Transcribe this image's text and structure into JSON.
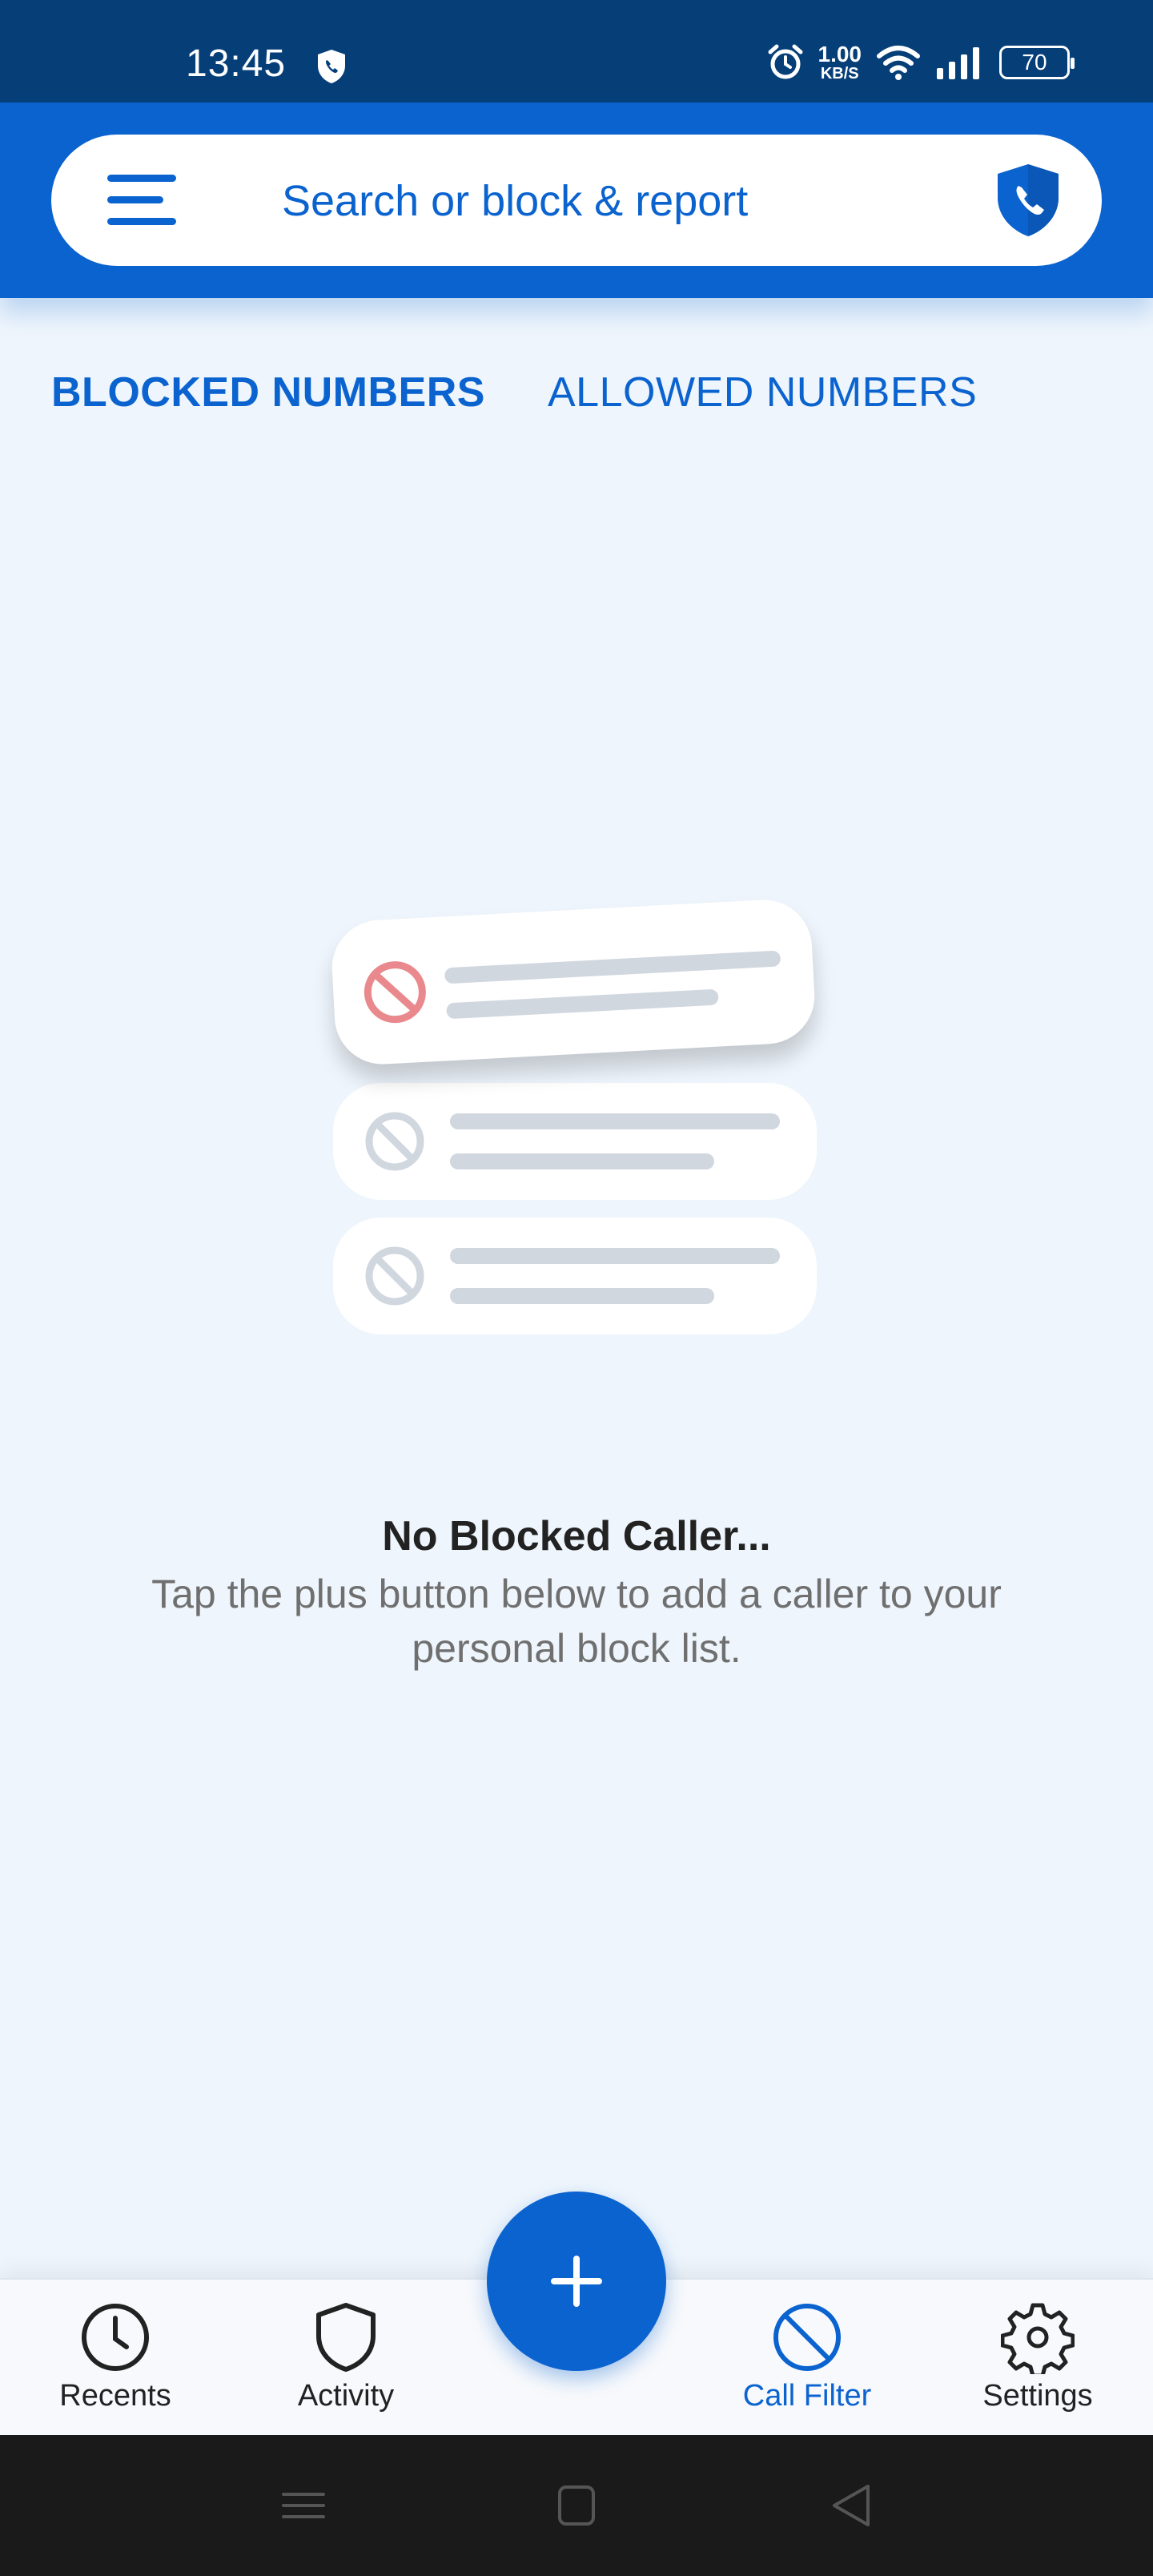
{
  "status_bar": {
    "time": "13:45",
    "network_speed_value": "1.00",
    "network_speed_unit": "KB/S",
    "battery_level": "70"
  },
  "header": {
    "search_placeholder": "Search or block & report"
  },
  "tabs": [
    {
      "label": "BLOCKED NUMBERS",
      "active": true
    },
    {
      "label": "ALLOWED NUMBERS",
      "active": false
    }
  ],
  "empty_state": {
    "title": "No Blocked Caller...",
    "description": "Tap the plus button below to add a caller to your personal block list."
  },
  "bottom_nav": {
    "items": [
      {
        "label": "Recents",
        "icon": "clock-icon",
        "active": false
      },
      {
        "label": "Activity",
        "icon": "shield-icon",
        "active": false
      },
      {
        "label": "Call Filter",
        "icon": "block-icon",
        "active": true
      },
      {
        "label": "Settings",
        "icon": "gear-icon",
        "active": false
      }
    ],
    "fab_icon": "plus-icon"
  },
  "colors": {
    "status_bar": "#063f78",
    "primary": "#0b63cf",
    "background": "#eef5fc",
    "nav_background": "#f7f9fc",
    "block_red": "#e9898d",
    "placeholder_gray": "#d0d7df"
  }
}
